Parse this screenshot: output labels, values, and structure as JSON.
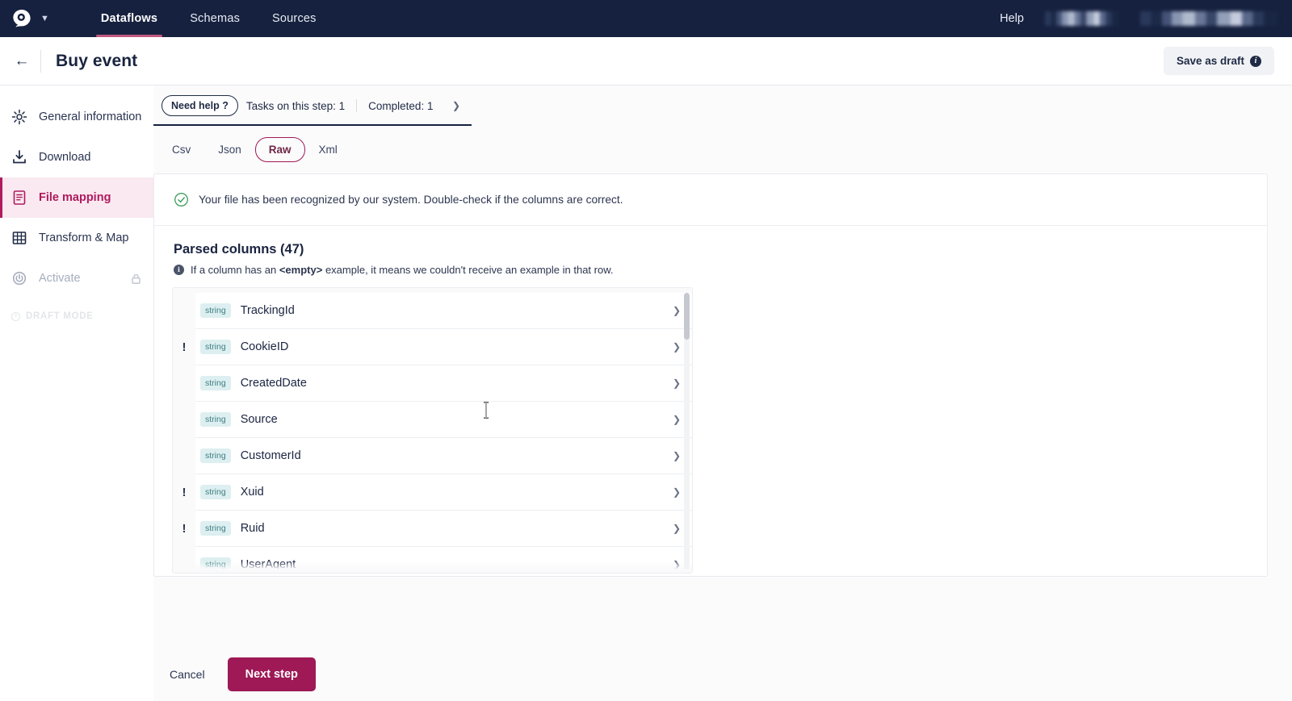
{
  "topnav": {
    "logo_icon": "owl-logo-icon",
    "caret_icon": "chevron-down-icon",
    "items": [
      {
        "label": "Dataflows",
        "active": true
      },
      {
        "label": "Schemas",
        "active": false
      },
      {
        "label": "Sources",
        "active": false
      }
    ],
    "help_label": "Help",
    "redacted_1": "",
    "redacted_2": "",
    "bg_color": "#16213f",
    "active_underline_color": "#c0577f"
  },
  "pagehead": {
    "back_icon": "arrow-left-icon",
    "title": "Buy event",
    "save_draft_label": "Save as draft",
    "save_draft_info_icon": "info-icon"
  },
  "sidebar": {
    "items": [
      {
        "label": "General information",
        "icon": "gear-icon",
        "active": false,
        "disabled": false,
        "locked": false
      },
      {
        "label": "Download",
        "icon": "download-icon",
        "active": false,
        "disabled": false,
        "locked": false
      },
      {
        "label": "File mapping",
        "icon": "document-icon",
        "active": true,
        "disabled": false,
        "locked": false
      },
      {
        "label": "Transform & Map",
        "icon": "table-icon",
        "active": false,
        "disabled": false,
        "locked": false
      },
      {
        "label": "Activate",
        "icon": "power-icon",
        "active": false,
        "disabled": true,
        "locked": true
      }
    ],
    "draft_mode_label": "DRAFT MODE",
    "active_color": "#b01a5f",
    "active_bg": "#fae9f0"
  },
  "statusstrip": {
    "need_help_label": "Need help ?",
    "tasks_label": "Tasks on this step: 1",
    "completed_label": "Completed: 1",
    "expand_icon": "chevron-down-icon"
  },
  "formattabs": {
    "items": [
      {
        "label": "Csv",
        "active": false
      },
      {
        "label": "Json",
        "active": false
      },
      {
        "label": "Raw",
        "active": true
      },
      {
        "label": "Xml",
        "active": false
      }
    ],
    "active_color": "#9e1955"
  },
  "card": {
    "alert": {
      "icon": "check-circle-icon",
      "text": "Your file has been recognized by our system. Double-check if the columns are correct.",
      "icon_color": "#3f9e5c"
    },
    "section_title": "Parsed columns (47)",
    "hint": {
      "icon": "info-icon",
      "prefix": "If a column has an ",
      "bold": "<empty>",
      "suffix": " example, it means we couldn't receive an example in that row."
    },
    "columns": [
      {
        "type": "string",
        "name": "TrackingId",
        "warning": false,
        "caret_icon": "chevron-down-icon"
      },
      {
        "type": "string",
        "name": "CookieID",
        "warning": true,
        "caret_icon": "chevron-down-icon"
      },
      {
        "type": "string",
        "name": "CreatedDate",
        "warning": false,
        "caret_icon": "chevron-down-icon"
      },
      {
        "type": "string",
        "name": "Source",
        "warning": false,
        "caret_icon": "chevron-down-icon"
      },
      {
        "type": "string",
        "name": "CustomerId",
        "warning": false,
        "caret_icon": "chevron-down-icon"
      },
      {
        "type": "string",
        "name": "Xuid",
        "warning": true,
        "caret_icon": "chevron-down-icon"
      },
      {
        "type": "string",
        "name": "Ruid",
        "warning": true,
        "caret_icon": "chevron-down-icon"
      },
      {
        "type": "string",
        "name": "UserAgent",
        "warning": false,
        "caret_icon": "chevron-down-icon"
      }
    ],
    "warning_marker": "!",
    "type_badge_bg": "#ddeff0",
    "type_badge_color": "#3f7f84"
  },
  "footer": {
    "cancel_label": "Cancel",
    "next_label": "Next step",
    "next_color": "#9e1955"
  }
}
